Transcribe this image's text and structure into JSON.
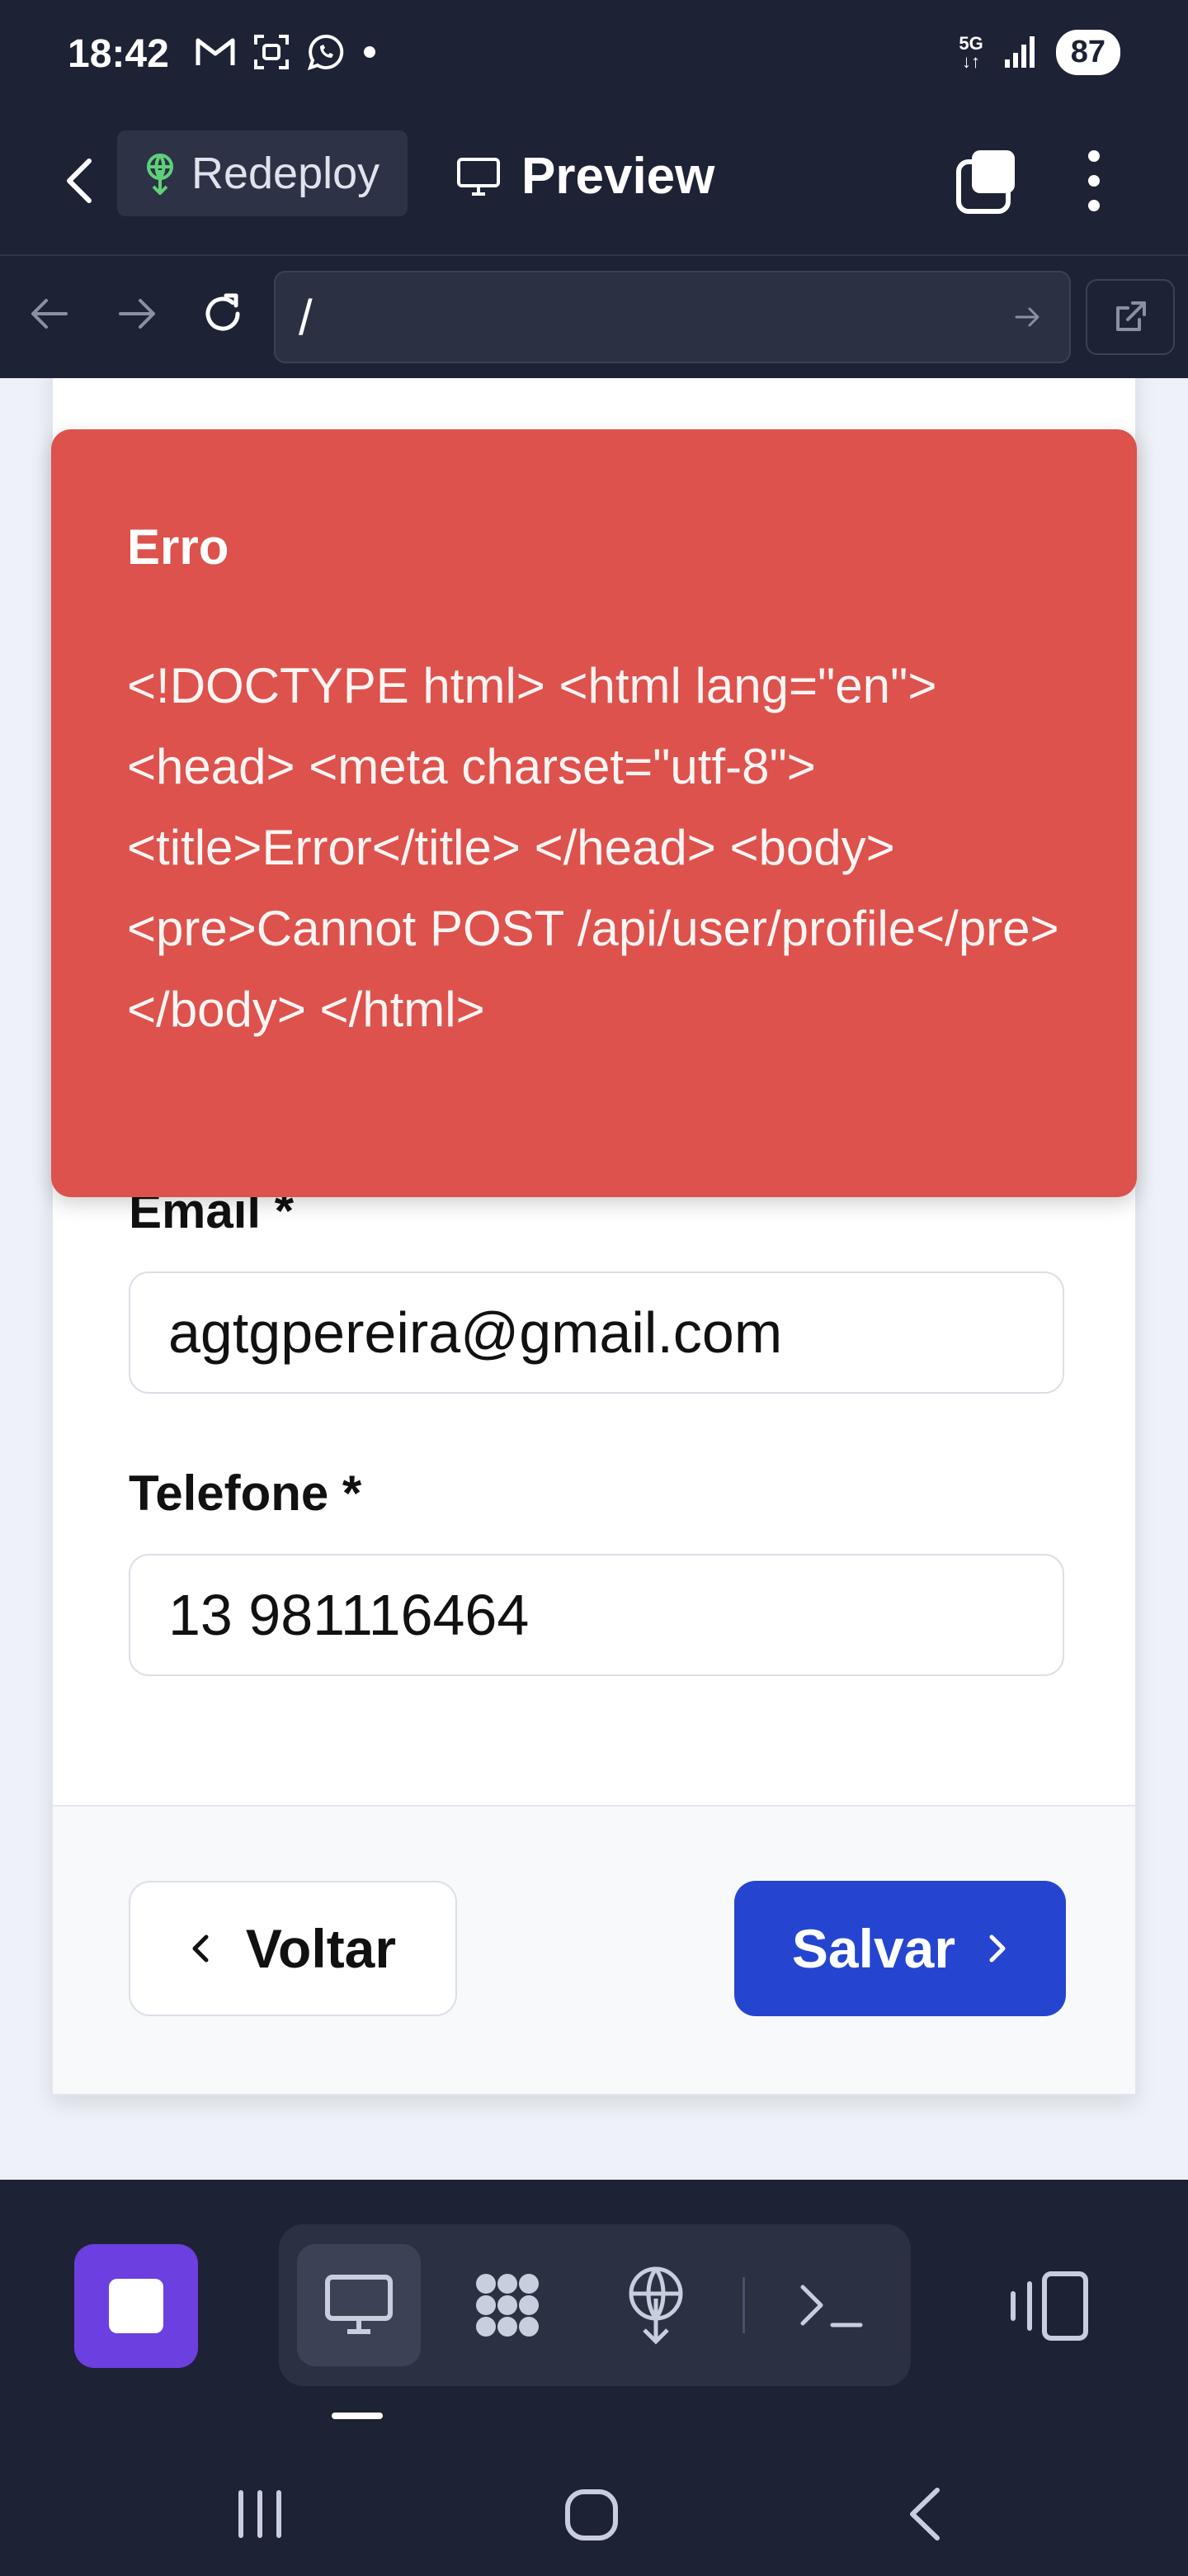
{
  "status_bar": {
    "time": "18:42",
    "network": "5G",
    "battery": "87",
    "icons": [
      "gmail-icon",
      "screenshot-icon",
      "whatsapp-icon",
      "notification-dot-icon",
      "5g-icon",
      "signal-icon",
      "battery-icon"
    ]
  },
  "header": {
    "redeploy_label": "Redeploy",
    "title": "Preview"
  },
  "url_bar": {
    "url": "/"
  },
  "error_toast": {
    "title": "Erro",
    "message": "<!DOCTYPE html> <html lang=\"en\"> <head> <meta charset=\"utf-8\"> <title>Error</title> </head> <body> <pre>Cannot POST /api/user/profile</pre> </body> </html>"
  },
  "form": {
    "email_label": "Email *",
    "email_value": "agtgpereira@gmail.com",
    "phone_label": "Telefone *",
    "phone_value": "13 981116464",
    "back_label": "Voltar",
    "save_label": "Salvar"
  },
  "colors": {
    "chrome_bg": "#1e2235",
    "error_bg": "#dd524c",
    "primary": "#2545d1",
    "stop_button": "#6c3fe0"
  }
}
